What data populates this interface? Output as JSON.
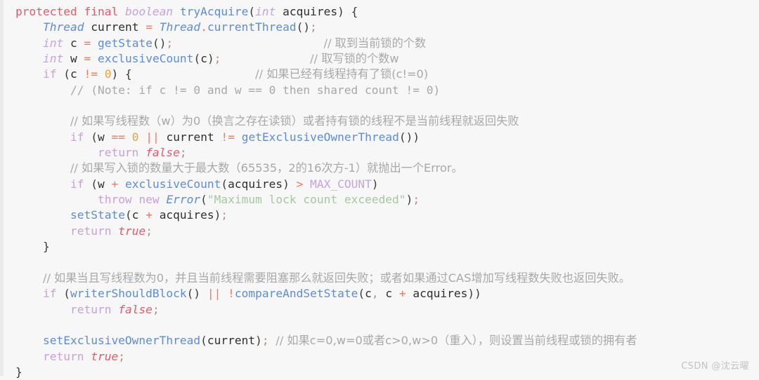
{
  "viewer": {
    "background_color": "#f7f7f7",
    "language": "java",
    "title": "tryAcquire code snippet"
  },
  "palette": {
    "keyword": "#e05c6e",
    "keyword_control": "#c9a0dc",
    "type": "#c5a3e0",
    "class": "#5b8dd9",
    "function": "#5b8dd9",
    "operator": "#f07a63",
    "number": "#e8a33d",
    "boolean": "#e05c6e",
    "string": "#a6c8a0",
    "comment": "#a8a8a8",
    "plain": "#2f2f2f",
    "background": "#f7f7f7"
  },
  "code": {
    "line01": {
      "kw_protected": "protected",
      "kw_final": "final",
      "type_boolean": "boolean",
      "fn_tryAcquire": "tryAcquire",
      "paren_open": "(",
      "type_int": "int",
      "param_acquires": "acquires",
      "paren_close": ")",
      "brace_open": "{"
    },
    "line02": {
      "cls_Thread": "Thread",
      "var_current": "current",
      "op_eq": "=",
      "cls_Thread2": "Thread",
      "dot": ".",
      "fn_currentThread": "currentThread",
      "parens": "()",
      "semi": ";"
    },
    "line03": {
      "type_int": "int",
      "var_c": "c",
      "op_eq": "=",
      "fn_getState": "getState",
      "parens": "()",
      "semi": ";",
      "comment": "// 取到当前锁的个数"
    },
    "line04": {
      "type_int": "int",
      "var_w": "w",
      "op_eq": "=",
      "fn_exclusiveCount": "exclusiveCount",
      "paren_open": "(",
      "arg_c": "c",
      "paren_close": ")",
      "semi": ";",
      "comment": "// 取写锁的个数w"
    },
    "line05": {
      "kw_if": "if",
      "paren_open": "(",
      "var_c": "c",
      "op_ne": "!=",
      "num_zero": "0",
      "paren_close": ")",
      "brace_open": "{",
      "comment": "// 如果已经有线程持有了锁(c!=0)"
    },
    "line06": {
      "comment": "// (Note: if c != 0 and w == 0 then shared count != 0)"
    },
    "line07": {
      "blank": ""
    },
    "line08": {
      "comment": "// 如果写线程数（w）为0（换言之存在读锁）或者持有锁的线程不是当前线程就返回失败"
    },
    "line09": {
      "kw_if": "if",
      "paren_open": "(",
      "var_w": "w",
      "op_eqeq": "==",
      "num_zero": "0",
      "op_or": "||",
      "var_current": "current",
      "op_ne": "!=",
      "fn_getExclusiveOwnerThread": "getExclusiveOwnerThread",
      "parens": "()",
      "paren_close": ")"
    },
    "line10": {
      "kw_return": "return",
      "bool_false": "false",
      "semi": ";"
    },
    "line11": {
      "comment": "// 如果写入锁的数量大于最大数（65535，2的16次方-1）就抛出一个Error。"
    },
    "line12": {
      "kw_if": "if",
      "paren_open": "(",
      "var_w": "w",
      "op_plus": "+",
      "fn_exclusiveCount": "exclusiveCount",
      "arg_open": "(",
      "arg_acquires": "acquires",
      "arg_close": ")",
      "op_gt": ">",
      "const_MAX_COUNT": "MAX_COUNT",
      "paren_close": ")"
    },
    "line13": {
      "kw_throw": "throw",
      "kw_new": "new",
      "cls_Error": "Error",
      "paren_open": "(",
      "string": "\"Maximum lock count exceeded\"",
      "paren_close": ")",
      "semi": ";"
    },
    "line14": {
      "fn_setState": "setState",
      "paren_open": "(",
      "var_c": "c",
      "op_plus": "+",
      "var_acquires": "acquires",
      "paren_close": ")",
      "semi": ";"
    },
    "line15": {
      "kw_return": "return",
      "bool_true": "true",
      "semi": ";"
    },
    "line16": {
      "brace_close": "}"
    },
    "line17": {
      "blank": ""
    },
    "line18": {
      "comment": "// 如果当且写线程数为0，并且当前线程需要阻塞那么就返回失败；或者如果通过CAS增加写线程数失败也返回失败。"
    },
    "line19": {
      "kw_if": "if",
      "paren_open": "(",
      "fn_writerShouldBlock": "writerShouldBlock",
      "parens": "()",
      "op_or": "||",
      "op_not": "!",
      "fn_compareAndSetState": "compareAndSetState",
      "arg_open": "(",
      "arg_c": "c",
      "comma": ",",
      "arg_c2": "c",
      "op_plus": "+",
      "arg_acquires": "acquires",
      "arg_close": ")",
      "paren_close": ")"
    },
    "line20": {
      "kw_return": "return",
      "bool_false": "false",
      "semi": ";"
    },
    "line21": {
      "blank": ""
    },
    "line22": {
      "fn_setExclusiveOwnerThread": "setExclusiveOwnerThread",
      "paren_open": "(",
      "arg_current": "current",
      "paren_close": ")",
      "semi": ";",
      "comment": "// 如果c=0,w=0或者c>0,w>0（重入），则设置当前线程或锁的拥有者"
    },
    "line23": {
      "kw_return": "return",
      "bool_true": "true",
      "semi": ";"
    },
    "line24": {
      "brace_close": "}"
    }
  },
  "watermark": {
    "text": "CSDN @沈云曜"
  }
}
